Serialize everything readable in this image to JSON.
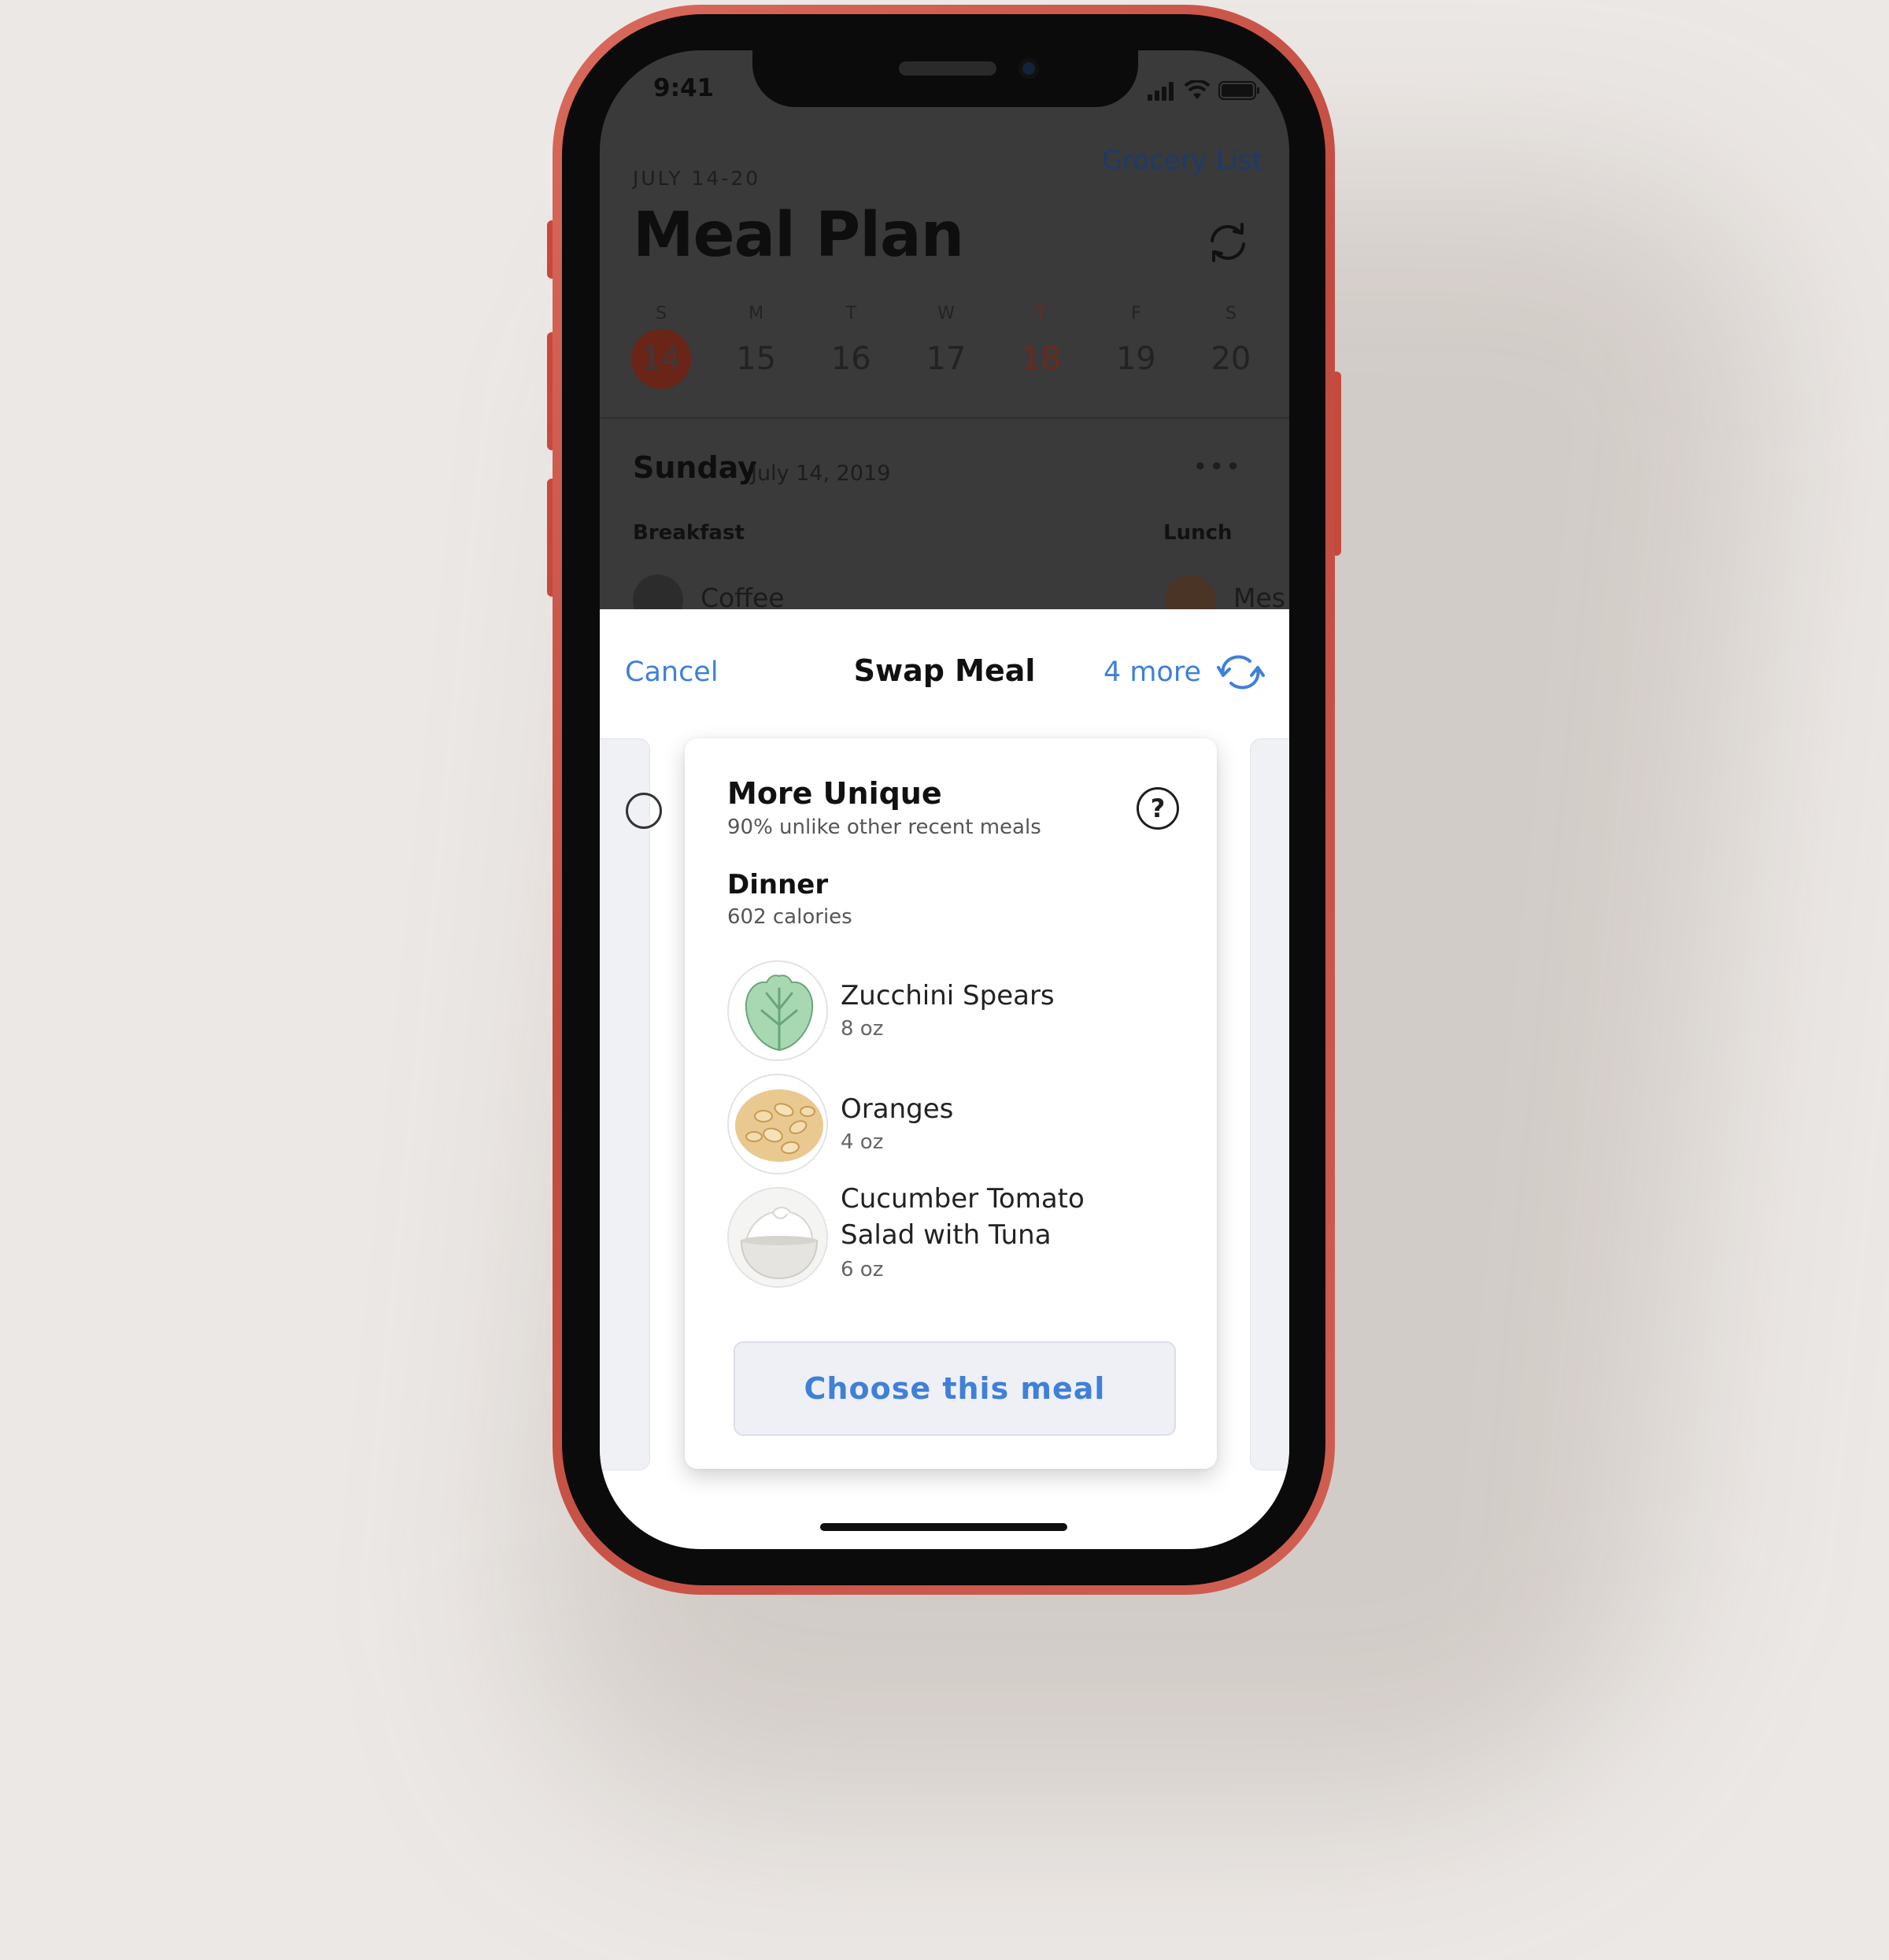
{
  "status_bar": {
    "time": "9:41"
  },
  "header": {
    "grocery_link": "Grocery List",
    "week_range": "JULY 14-20",
    "title": "Meal Plan"
  },
  "days": [
    {
      "letter": "S",
      "num": "14",
      "state": "selected"
    },
    {
      "letter": "M",
      "num": "15",
      "state": ""
    },
    {
      "letter": "T",
      "num": "16",
      "state": ""
    },
    {
      "letter": "W",
      "num": "17",
      "state": ""
    },
    {
      "letter": "T",
      "num": "18",
      "state": "today"
    },
    {
      "letter": "F",
      "num": "19",
      "state": ""
    },
    {
      "letter": "S",
      "num": "20",
      "state": ""
    }
  ],
  "day_section": {
    "day_name": "Sunday",
    "date": "July 14, 2019",
    "breakfast_label": "Breakfast",
    "lunch_label": "Lunch",
    "breakfast_item": "Coffee",
    "lunch_item": "Mes"
  },
  "sheet": {
    "cancel": "Cancel",
    "title": "Swap Meal",
    "more": "4 more"
  },
  "card": {
    "title": "More Unique",
    "subtitle": "90% unlike other recent meals",
    "help": "?",
    "meal": "Dinner",
    "calories": "602 calories",
    "foods": [
      {
        "name": "Zucchini Spears",
        "amount": "8 oz",
        "icon": "lettuce-icon"
      },
      {
        "name": "Oranges",
        "amount": "4 oz",
        "icon": "oats-icon"
      },
      {
        "name_line1": "Cucumber Tomato",
        "name_line2": "Salad with Tuna",
        "amount": "6 oz",
        "icon": "yogurt-bowl-icon"
      }
    ],
    "choose_button": "Choose this meal"
  },
  "colors": {
    "accent": "#3f80d8",
    "phone_frame": "#c94e42",
    "selected_day": "#6b2418"
  }
}
